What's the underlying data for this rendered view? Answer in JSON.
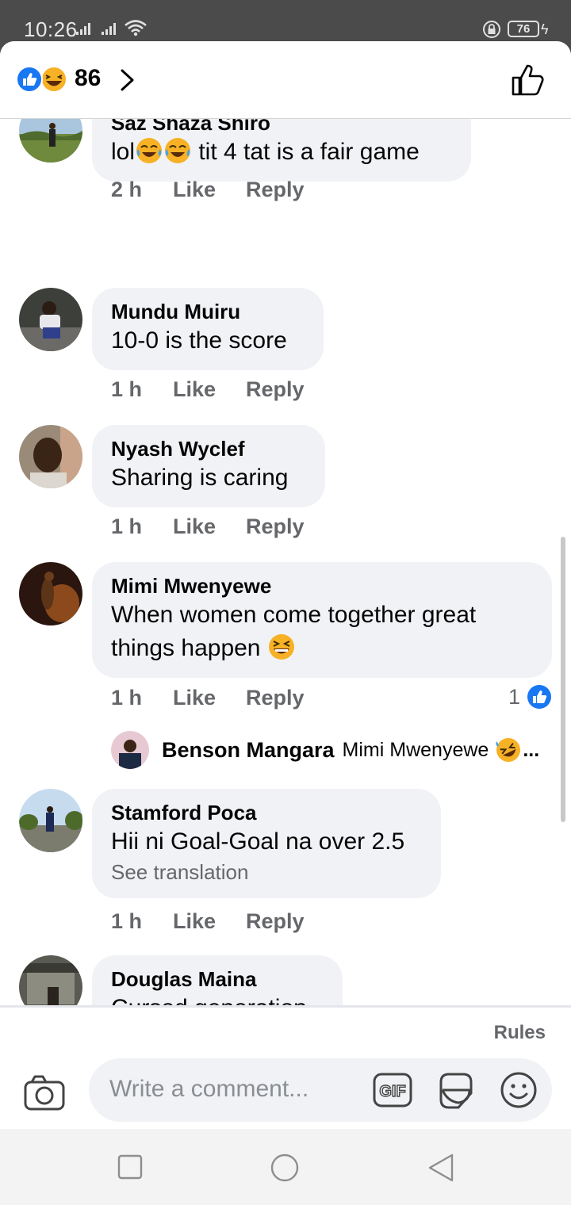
{
  "status_bar": {
    "time": "10:26",
    "battery": "76"
  },
  "header": {
    "reaction_count": "86",
    "reaction_icons": [
      "like-icon",
      "haha-icon"
    ]
  },
  "comments": [
    {
      "author": "Saz Shaza Shiro",
      "text_before_emoji": "lol",
      "text_after_emoji": " tit 4 tat is a fair game",
      "time": "2 h",
      "like_label": "Like",
      "reply_label": "Reply"
    },
    {
      "author": "Mundu Muiru",
      "text": "10-0 is the score",
      "time": "1 h",
      "like_label": "Like",
      "reply_label": "Reply"
    },
    {
      "author": "Nyash Wyclef",
      "text": "Sharing is caring",
      "time": "1 h",
      "like_label": "Like",
      "reply_label": "Reply"
    },
    {
      "author": "Mimi Mwenyewe",
      "text_line1": "When women come together great",
      "text_line2": "things happen",
      "time": "1 h",
      "like_label": "Like",
      "reply_label": "Reply",
      "reaction_count": "1"
    },
    {
      "author": "Stamford Poca",
      "text": "Hii ni Goal-Goal na over 2.5",
      "see_translation": "See translation",
      "time": "1 h",
      "like_label": "Like",
      "reply_label": "Reply"
    },
    {
      "author": "Douglas Maina",
      "text": "Cursed generation"
    }
  ],
  "reply": {
    "author": "Benson Mangara",
    "text": "Mimi Mwenyewe",
    "ellipsis": "..."
  },
  "footer": {
    "rules": "Rules",
    "placeholder": "Write a comment...",
    "gif": "GIF"
  },
  "colors": {
    "bubble": "#f0f2f5",
    "meta": "#65676b",
    "like_blue": "#1877f2",
    "haha_yellow": "#f7b125"
  }
}
